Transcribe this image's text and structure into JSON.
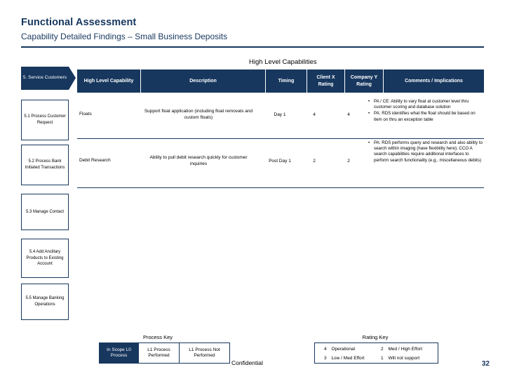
{
  "header": {
    "title": "Functional Assessment",
    "subtitle": "Capability Detailed Findings – Small Business Deposits"
  },
  "section_label": "High Level Capabilities",
  "left_tab": {
    "label": "5. Service Customers"
  },
  "left_rows": [
    {
      "label": "5.1 Process Customer Request"
    },
    {
      "label": "5.2 Process Bank Initiated Transactions"
    },
    {
      "label": "5.3 Manage Contact"
    },
    {
      "label": "5.4 Add Ancillary Products to Existing Account"
    },
    {
      "label": "5.5 Manage Banking Operations"
    }
  ],
  "table": {
    "columns": [
      "High Level Capability",
      "Description",
      "Timing",
      "Client X Rating",
      "Company Y Rating",
      "Comments / Implications"
    ],
    "rows": [
      {
        "capability": "Floats",
        "description": "Support float application (including float removals and custom floats)",
        "timing": "Day 1",
        "client_rating": "4",
        "company_rating": "4",
        "comments": [
          "PA / CE: Ability to vary float at customer level thru customer scoring and database solution",
          "PA: RDS identifies what the float should be based on item on thru an exception table"
        ]
      },
      {
        "capability": "Debit Research",
        "description": "Ability to pull debit research quickly for customer inquiries",
        "timing": "Post Day 1",
        "client_rating": "2",
        "company_rating": "2",
        "comments": [
          "PA: RDS performs query and research and also ability to search within imaging (have flexibility here); CCO A search capabilities require additional interfaces to perform search functionality (e.g., miscellaneous debits)"
        ]
      }
    ]
  },
  "process_key": {
    "title": "Process Key",
    "items": [
      "In Scope L0 Process",
      "L1 Process Performed",
      "L1 Process Not Performed"
    ]
  },
  "rating_key": {
    "title": "Rating Key",
    "items": [
      {
        "num": "4",
        "text": "Operational"
      },
      {
        "num": "2",
        "text": "Med / High Effort"
      },
      {
        "num": "3",
        "text": "Low / Med Effort"
      },
      {
        "num": "1",
        "text": "Will not support"
      }
    ]
  },
  "footer": {
    "confidential": "Confidential",
    "page_number": "32"
  },
  "colors": {
    "navy": "#17375E",
    "white": "#FFFFFF"
  }
}
